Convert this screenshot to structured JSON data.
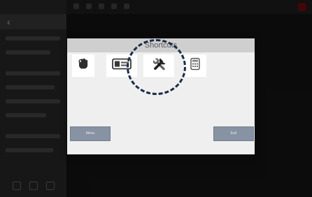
{
  "dialog": {
    "title": "Shortcuts",
    "shortcuts": [
      {
        "icon": "hand-click-icon"
      },
      {
        "icon": "id-card-icon"
      },
      {
        "icon": "tools-icon"
      },
      {
        "icon": "calculator-icon"
      }
    ],
    "menu_label": "Menu",
    "exit_label": "Exit"
  },
  "colors": {
    "dialog_bg": "#efefef",
    "title_bar": "#cfcfcf",
    "button_bg": "#8793a3",
    "highlight_circle": "#1a2b4a"
  }
}
